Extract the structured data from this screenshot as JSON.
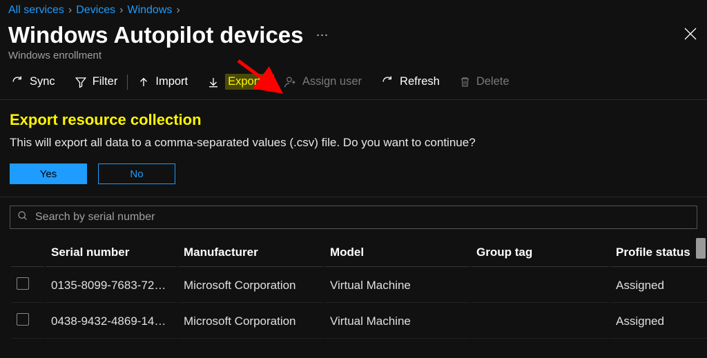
{
  "breadcrumbs": [
    {
      "label": "All services"
    },
    {
      "label": "Devices"
    },
    {
      "label": "Windows"
    }
  ],
  "header": {
    "title": "Windows Autopilot devices",
    "subtitle": "Windows enrollment"
  },
  "toolbar": {
    "sync": "Sync",
    "filter": "Filter",
    "import": "Import",
    "export": "Export",
    "assign_user": "Assign user",
    "refresh": "Refresh",
    "delete": "Delete"
  },
  "prompt": {
    "title": "Export resource collection",
    "text": "This will export all data to a comma-separated values (.csv) file. Do you want to continue?",
    "yes": "Yes",
    "no": "No"
  },
  "search": {
    "placeholder": "Search by serial number"
  },
  "columns": {
    "serial": "Serial number",
    "mfr": "Manufacturer",
    "model": "Model",
    "group": "Group tag",
    "profile": "Profile status"
  },
  "rows": [
    {
      "serial": "0135-8099-7683-72…",
      "mfr": "Microsoft Corporation",
      "model": "Virtual Machine",
      "group": "",
      "profile": "Assigned"
    },
    {
      "serial": "0438-9432-4869-14…",
      "mfr": "Microsoft Corporation",
      "model": "Virtual Machine",
      "group": "",
      "profile": "Assigned"
    }
  ]
}
